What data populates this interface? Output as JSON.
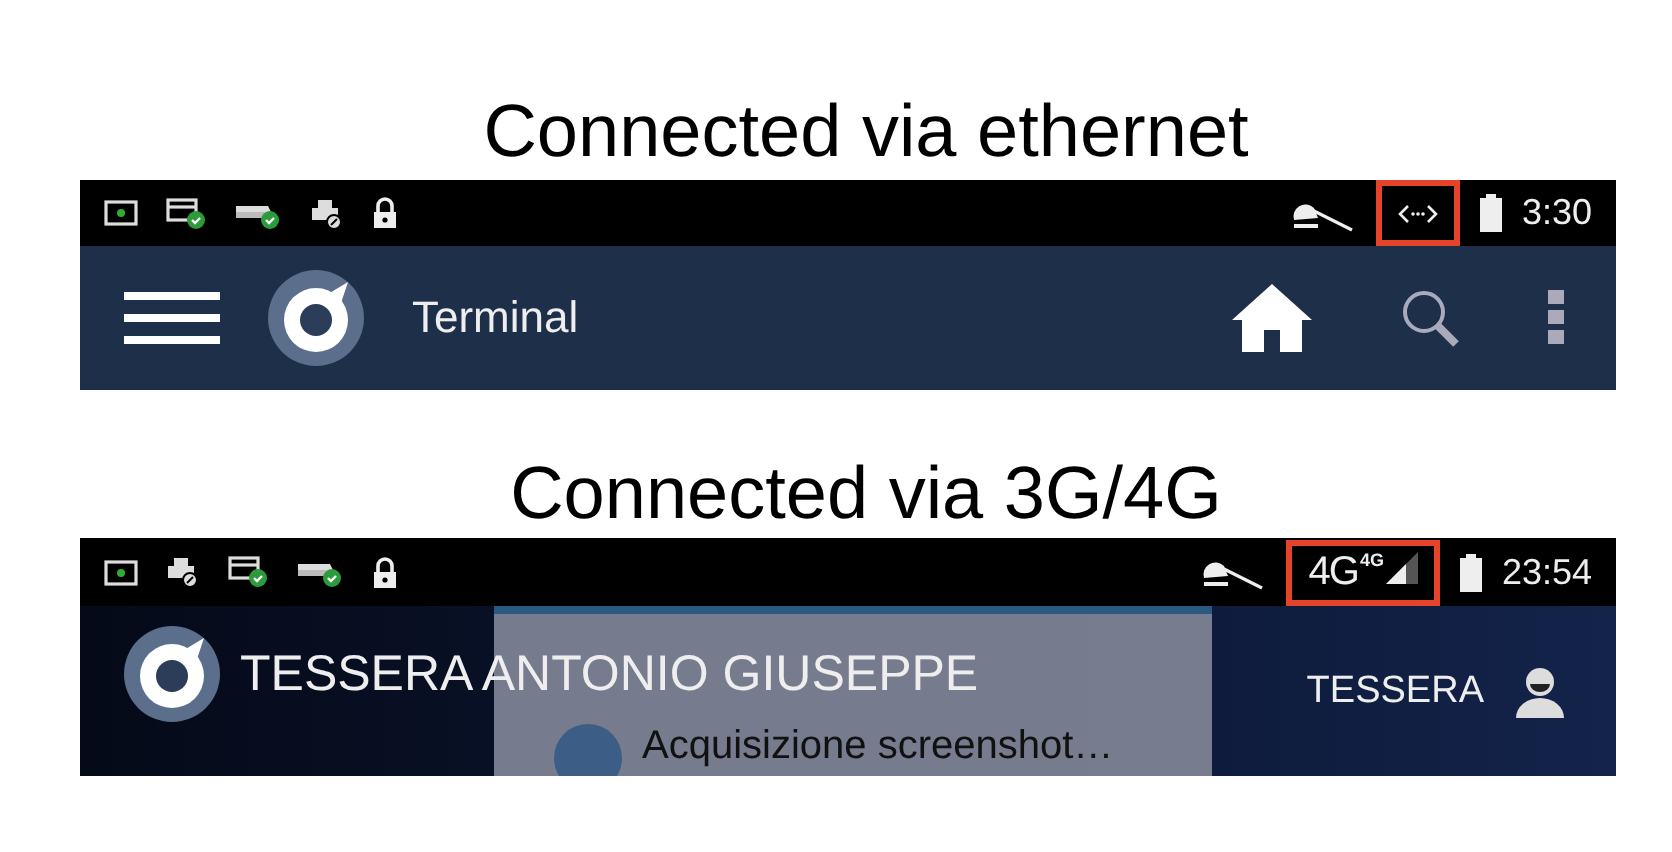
{
  "panels": [
    {
      "caption": "Connected via ethernet",
      "status_bar": {
        "left_icons": [
          {
            "kind": "screen"
          },
          {
            "kind": "card-check"
          },
          {
            "kind": "drive-check"
          },
          {
            "kind": "printer"
          },
          {
            "kind": "lock"
          }
        ],
        "network": {
          "kind": "ethernet",
          "highlighted": true
        },
        "time": "3:30"
      },
      "app_bar": {
        "kind": "navigation",
        "title": "Terminal",
        "actions": [
          {
            "kind": "home"
          },
          {
            "kind": "search"
          },
          {
            "kind": "more"
          }
        ]
      }
    },
    {
      "caption": "Connected via 3G/4G",
      "status_bar": {
        "left_icons": [
          {
            "kind": "screen"
          },
          {
            "kind": "printer"
          },
          {
            "kind": "card-check"
          },
          {
            "kind": "drive-check"
          },
          {
            "kind": "lock"
          }
        ],
        "network": {
          "kind": "cellular",
          "label": "4G",
          "badge": "4G",
          "highlighted": true
        },
        "time": "23:54"
      },
      "app_bar": {
        "kind": "profile",
        "title": "TESSERA ANTONIO GIUSEPPE",
        "account_label": "TESSERA",
        "toast": "Acquisizione screenshot…"
      }
    }
  ]
}
